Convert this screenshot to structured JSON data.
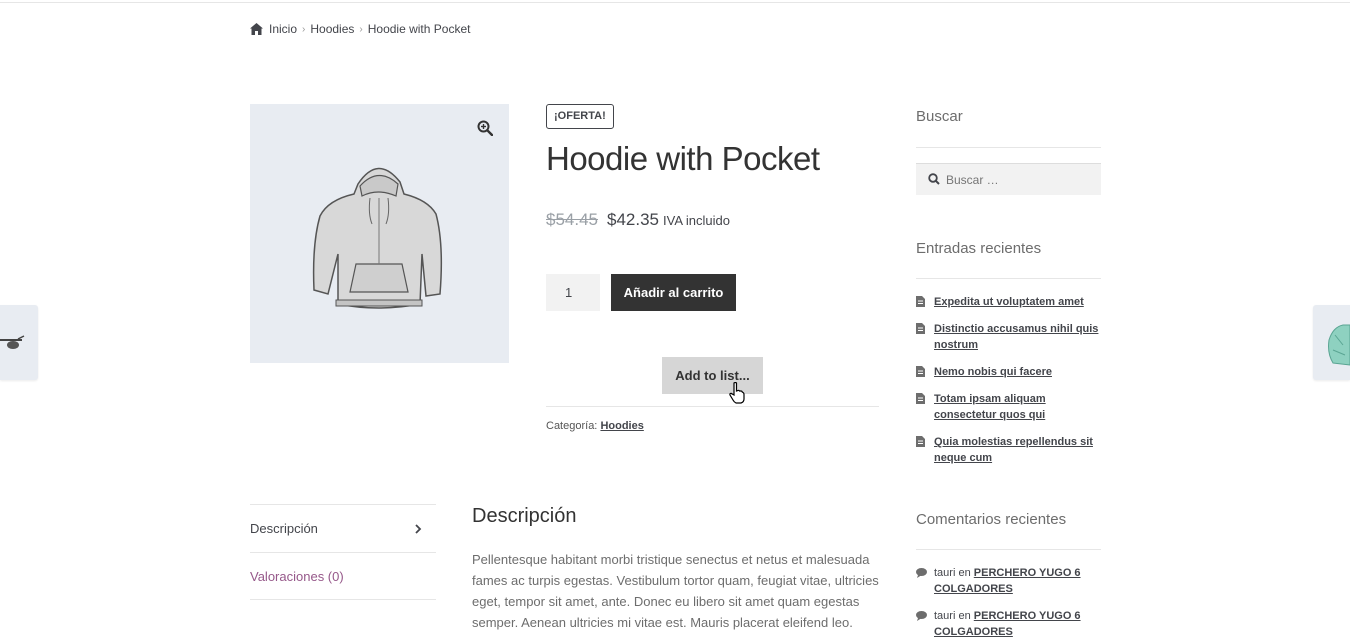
{
  "breadcrumb": {
    "home_icon": "home-icon",
    "items": [
      "Inicio",
      "Hoodies",
      "Hoodie with Pocket"
    ]
  },
  "product": {
    "badge": "¡OFERTA!",
    "title": "Hoodie with Pocket",
    "old_price": "$54.45",
    "new_price": "$42.35",
    "tax_note": "IVA incluido",
    "quantity": "1",
    "add_to_cart_label": "Añadir al carrito",
    "add_to_list_label": "Add to list...",
    "category_label": "Categoría:",
    "category_value": "Hoodies"
  },
  "tabs": [
    {
      "label": "Descripción"
    },
    {
      "label": "Valoraciones (0)"
    }
  ],
  "description": {
    "title": "Descripción",
    "body": "Pellentesque habitant morbi tristique senectus et netus et malesuada fames ac turpis egestas. Vestibulum tortor quam, feugiat vitae, ultricies eget, tempor sit amet, ante. Donec eu libero sit amet quam egestas semper. Aenean ultricies mi vitae est. Mauris placerat eleifend leo."
  },
  "sidebar": {
    "search_title": "Buscar",
    "search_placeholder": "Buscar …",
    "recent_posts_title": "Entradas recientes",
    "recent_posts": [
      "Expedita ut voluptatem amet",
      "Distinctio accusamus nihil quis nostrum",
      "Nemo nobis qui facere",
      "Totam ipsam aliquam consectetur quos qui",
      "Quia molestias repellendus sit neque cum"
    ],
    "recent_comments_title": "Comentarios recientes",
    "recent_comments": [
      {
        "author": "tauri",
        "connector": "en",
        "post": "PERCHERO YUGO 6 COLGADORES"
      },
      {
        "author": "tauri",
        "connector": "en",
        "post": "PERCHERO YUGO 6 COLGADORES"
      }
    ]
  },
  "colors": {
    "accent_purple": "#96588a",
    "button_dark": "#333333",
    "gallery_bg": "#e8ecf2"
  }
}
